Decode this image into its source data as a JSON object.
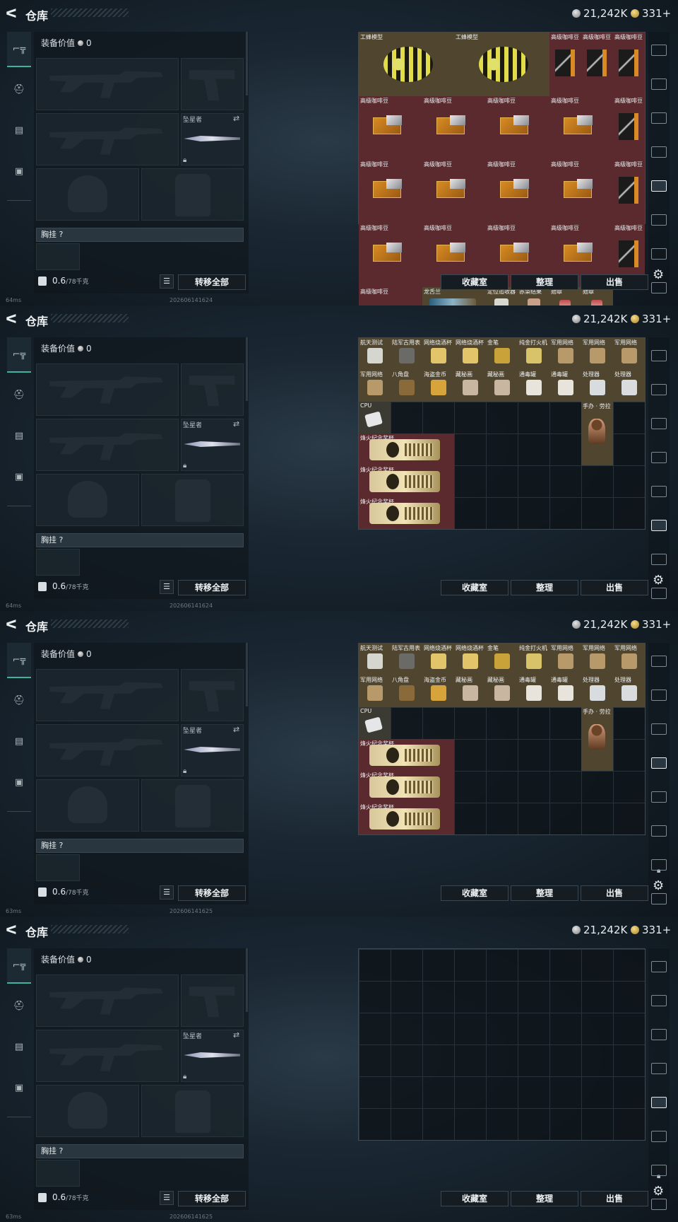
{
  "header": {
    "back_glyph": "ᐸ",
    "title": "仓库",
    "silver_value": "21,242K",
    "gold_value": "331+"
  },
  "left": {
    "equip_value_label": "装备价值",
    "equip_value": "0",
    "melee_label": "坠星者",
    "chest_label": "胸挂 ?",
    "weight_value": "0.6",
    "weight_max": "/78千克",
    "transfer_all": "转移全部",
    "list_glyph": "☰"
  },
  "nav_icons": [
    "gun-icon",
    "helmet-icon",
    "vest-icon",
    "bag-icon"
  ],
  "actions": {
    "collection": "收藏室",
    "organize": "整理",
    "sell": "出售"
  },
  "statusbar": [
    "64ms",
    "64ms",
    "63ms",
    "63ms"
  ],
  "timestamps": [
    "202606141624",
    "202606141624",
    "202606141625",
    "202606141625"
  ],
  "frame1_items": {
    "bee_label": "工蜂模型",
    "coffee_label": "高级咖啡豆",
    "dragon_label": "龙舌兰",
    "locator_label": "定位追收器",
    "red_brochure_label": "赤枭结果",
    "medal_label": "勋章"
  },
  "frame2_items": {
    "labels": [
      "航天测试",
      "陆军古用表",
      "网络烧酒杯",
      "网络烧酒杯",
      "金笔",
      "纯金打火机",
      "军用网络",
      "军用网络",
      "军用网络",
      "军用网络",
      "八角盘",
      "海盗金币",
      "藏秘画",
      "藏秘画",
      "通毒罐",
      "通毒罐",
      "处理器",
      "处理器"
    ],
    "cpu_label": "CPU",
    "figure_label": "手办 · 劳拉",
    "trophy_label": "烽火纪念奖杯"
  },
  "colors": {
    "accent": "#3fb39f",
    "red_cell": "#5a2a2e",
    "brown_cell": "#50452f"
  }
}
